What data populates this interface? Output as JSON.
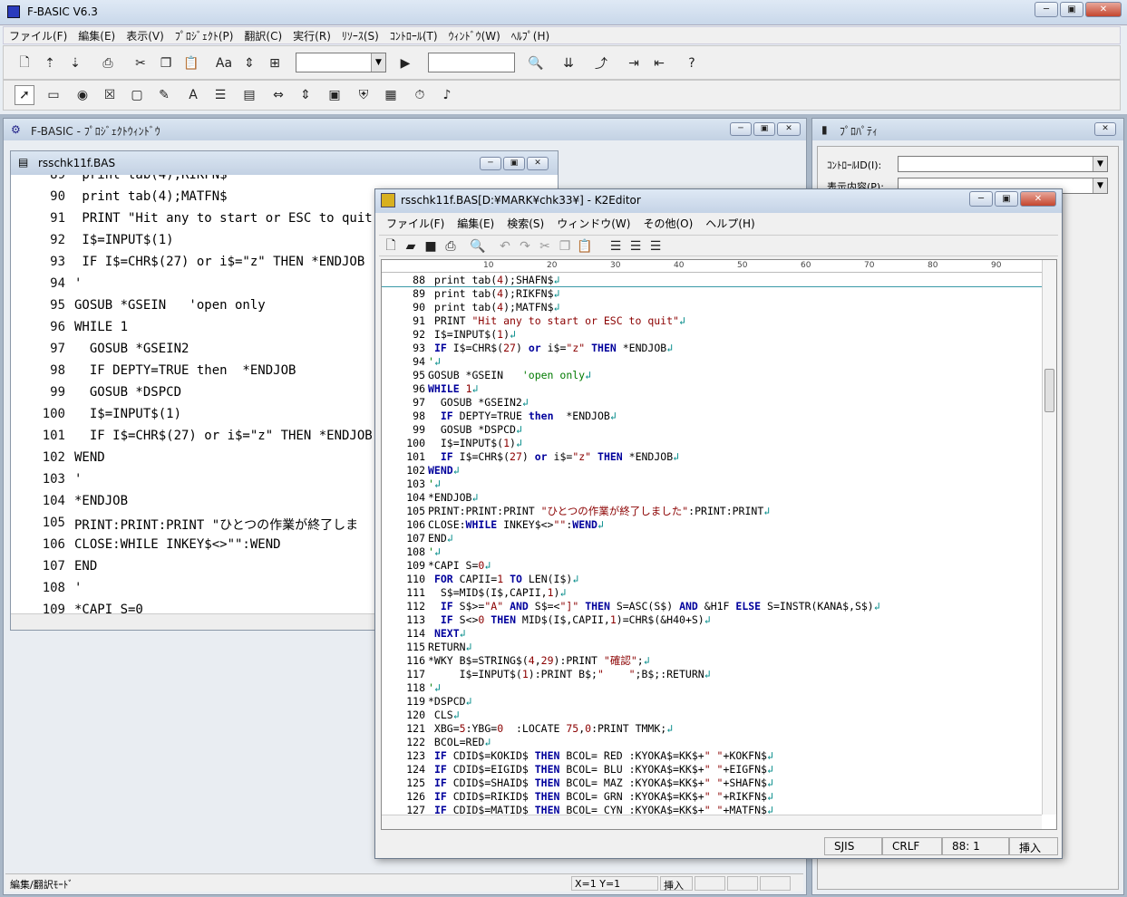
{
  "app": {
    "title": "F-BASIC V6.3"
  },
  "menubar": [
    "ファイル(F)",
    "編集(E)",
    "表示(V)",
    "ﾌﾟﾛｼﾞｪｸﾄ(P)",
    "翻訳(C)",
    "実行(R)",
    "ﾘｿｰｽ(S)",
    "ｺﾝﾄﾛｰﾙ(T)",
    "ｳｨﾝﾄﾞｳ(W)",
    "ﾍﾙﾌﾟ(H)"
  ],
  "project_window": {
    "title": "F-BASIC - ﾌﾟﾛｼﾞｪｸﾄｳｨﾝﾄﾞｳ"
  },
  "code_window": {
    "title": "rsschk11f.BAS",
    "lines": [
      {
        "n": "89",
        "t": " print tab(4);RIKFN$"
      },
      {
        "n": "90",
        "t": " print tab(4);MATFN$"
      },
      {
        "n": "91",
        "t": " PRINT \"Hit any to start or ESC to quit\""
      },
      {
        "n": "92",
        "t": " I$=INPUT$(1)"
      },
      {
        "n": "93",
        "t": " IF I$=CHR$(27) or i$=\"z\" THEN *ENDJOB"
      },
      {
        "n": "94",
        "t": "'"
      },
      {
        "n": "95",
        "t": "GOSUB *GSEIN   'open only"
      },
      {
        "n": "96",
        "t": "WHILE 1"
      },
      {
        "n": "97",
        "t": "  GOSUB *GSEIN2"
      },
      {
        "n": "98",
        "t": "  IF DEPTY=TRUE then  *ENDJOB"
      },
      {
        "n": "99",
        "t": "  GOSUB *DSPCD"
      },
      {
        "n": "100",
        "t": "  I$=INPUT$(1)"
      },
      {
        "n": "101",
        "t": "  IF I$=CHR$(27) or i$=\"z\" THEN *ENDJOB"
      },
      {
        "n": "102",
        "t": "WEND"
      },
      {
        "n": "103",
        "t": "'"
      },
      {
        "n": "104",
        "t": "*ENDJOB"
      },
      {
        "n": "105",
        "t": "PRINT:PRINT:PRINT \"ひとつの作業が終了しま"
      },
      {
        "n": "106",
        "t": "CLOSE:WHILE INKEY$<>\"\":WEND"
      },
      {
        "n": "107",
        "t": "END"
      },
      {
        "n": "108",
        "t": "'"
      },
      {
        "n": "109",
        "t": "*CAPI S=0"
      }
    ]
  },
  "statusbar": {
    "mode": "編集/翻訳ﾓｰﾄﾞ",
    "pos": "X=1 Y=1",
    "ins": "挿入"
  },
  "property_window": {
    "title": "ﾌﾟﾛﾊﾟﾃｨ",
    "control_id_label": "ｺﾝﾄﾛｰﾙID(I):",
    "display_label": "表示内容(P):"
  },
  "k2": {
    "title": "rsschk11f.BAS[D:¥MARK¥chk33¥] - K2Editor",
    "menu": [
      "ファイル(F)",
      "編集(E)",
      "検索(S)",
      "ウィンドウ(W)",
      "その他(O)",
      "ヘルプ(H)"
    ],
    "ruler": [
      "10",
      "20",
      "30",
      "40",
      "50",
      "60",
      "70",
      "80",
      "90"
    ],
    "status": {
      "enc": "SJIS",
      "eol": "CRLF",
      "pos": "88:  1",
      "mode": "挿入"
    },
    "lines": [
      {
        "n": "88",
        "t": " print tab(4);SHAFN$"
      },
      {
        "n": "89",
        "t": " print tab(4);RIKFN$"
      },
      {
        "n": "90",
        "t": " print tab(4);MATFN$"
      },
      {
        "n": "91",
        "t": " PRINT \"Hit any to start or ESC to quit\""
      },
      {
        "n": "92",
        "t": " I$=INPUT$(1)"
      },
      {
        "n": "93",
        "t": " IF I$=CHR$(27) or i$=\"z\" THEN *ENDJOB"
      },
      {
        "n": "94",
        "t": "'"
      },
      {
        "n": "95",
        "t": "GOSUB *GSEIN   'open only"
      },
      {
        "n": "96",
        "t": "WHILE 1"
      },
      {
        "n": "97",
        "t": "  GOSUB *GSEIN2"
      },
      {
        "n": "98",
        "t": "  IF DEPTY=TRUE then  *ENDJOB"
      },
      {
        "n": "99",
        "t": "  GOSUB *DSPCD"
      },
      {
        "n": "100",
        "t": "  I$=INPUT$(1)"
      },
      {
        "n": "101",
        "t": "  IF I$=CHR$(27) or i$=\"z\" THEN *ENDJOB"
      },
      {
        "n": "102",
        "t": "WEND"
      },
      {
        "n": "103",
        "t": "'"
      },
      {
        "n": "104",
        "t": "*ENDJOB"
      },
      {
        "n": "105",
        "t": "PRINT:PRINT:PRINT \"ひとつの作業が終了しました\":PRINT:PRINT"
      },
      {
        "n": "106",
        "t": "CLOSE:WHILE INKEY$<>\"\":WEND"
      },
      {
        "n": "107",
        "t": "END"
      },
      {
        "n": "108",
        "t": "'"
      },
      {
        "n": "109",
        "t": "*CAPI S=0"
      },
      {
        "n": "110",
        "t": " FOR CAPII=1 TO LEN(I$)"
      },
      {
        "n": "111",
        "t": "  S$=MID$(I$,CAPII,1)"
      },
      {
        "n": "112",
        "t": "  IF S$>=\"A\" AND S$=<\"]\" THEN S=ASC(S$) AND &H1F ELSE S=INSTR(KANA$,S$)"
      },
      {
        "n": "113",
        "t": "  IF S<>0 THEN MID$(I$,CAPII,1)=CHR$(&H40+S)"
      },
      {
        "n": "114",
        "t": " NEXT"
      },
      {
        "n": "115",
        "t": "RETURN"
      },
      {
        "n": "116",
        "t": "*WKY B$=STRING$(4,29):PRINT \"確認\";"
      },
      {
        "n": "117",
        "t": "     I$=INPUT$(1):PRINT B$;\"    \";B$;:RETURN"
      },
      {
        "n": "118",
        "t": "'"
      },
      {
        "n": "119",
        "t": "*DSPCD"
      },
      {
        "n": "120",
        "t": " CLS"
      },
      {
        "n": "121",
        "t": " XBG=5:YBG=0  :LOCATE 75,0:PRINT TMMK;"
      },
      {
        "n": "122",
        "t": " BCOL=RED"
      },
      {
        "n": "123",
        "t": " IF CDID$=KOKID$ THEN BCOL= RED :KYOKA$=KK$+\" \"+KOKFN$"
      },
      {
        "n": "124",
        "t": " IF CDID$=EIGID$ THEN BCOL= BLU :KYOKA$=KK$+\" \"+EIGFN$"
      },
      {
        "n": "125",
        "t": " IF CDID$=SHAID$ THEN BCOL= MAZ :KYOKA$=KK$+\" \"+SHAFN$"
      },
      {
        "n": "126",
        "t": " IF CDID$=RIKID$ THEN BCOL= GRN :KYOKA$=KK$+\" \"+RIKFN$"
      },
      {
        "n": "127",
        "t": " IF CDID$=MATID$ THEN BCOL= CYN :KYOKA$=KK$+\" \"+MATFN$"
      }
    ]
  }
}
